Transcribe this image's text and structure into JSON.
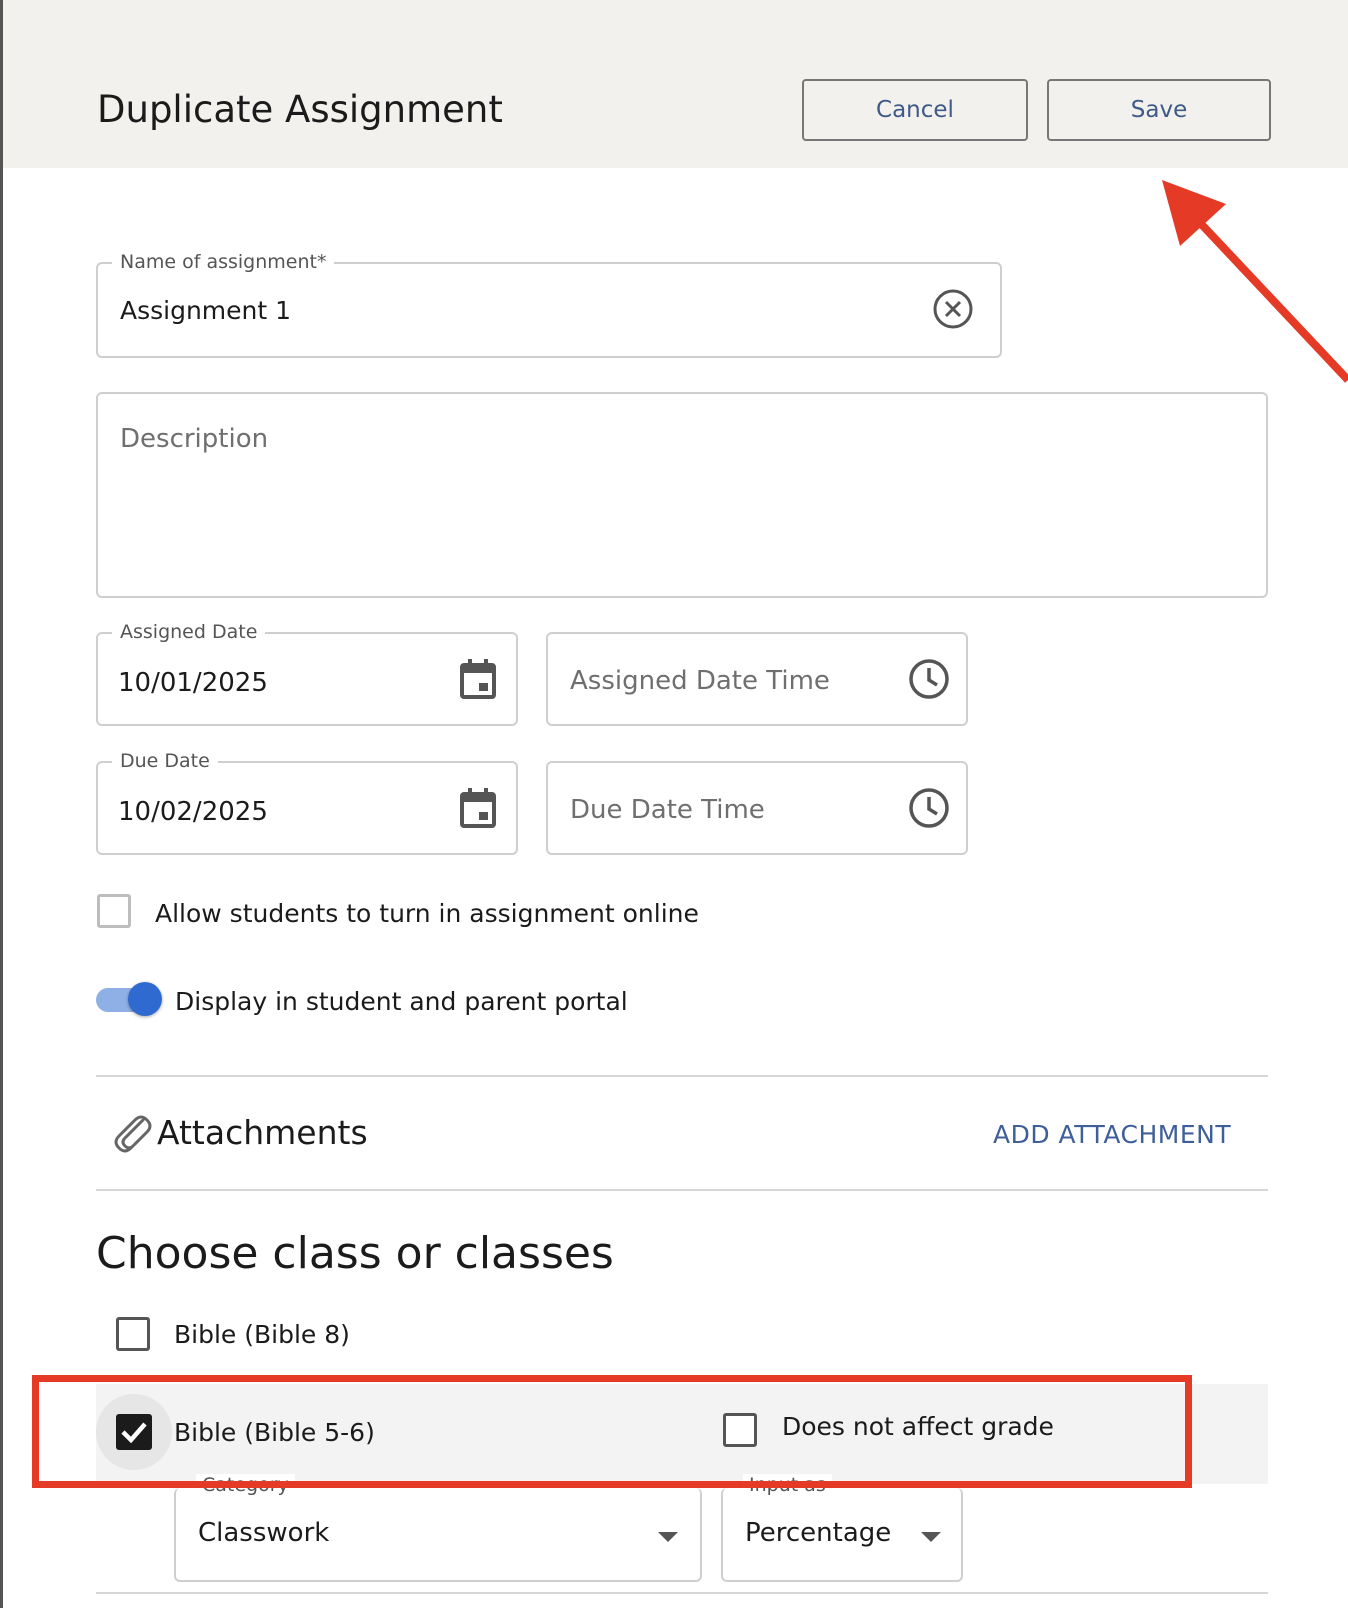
{
  "header": {
    "title": "Duplicate Assignment",
    "cancel_label": "Cancel",
    "save_label": "Save"
  },
  "form": {
    "name": {
      "label": "Name of assignment*",
      "value": "Assignment 1"
    },
    "description": {
      "placeholder": "Description",
      "value": ""
    },
    "assigned_date": {
      "label": "Assigned Date",
      "value": "10/01/2025"
    },
    "assigned_time": {
      "placeholder": "Assigned Date Time"
    },
    "due_date": {
      "label": "Due Date",
      "value": "10/02/2025"
    },
    "due_time": {
      "placeholder": "Due Date Time"
    },
    "allow_online": {
      "label": "Allow students to turn in assignment online",
      "checked": false
    },
    "display_portal": {
      "label": "Display in student and parent portal",
      "on": true
    }
  },
  "attachments": {
    "title": "Attachments",
    "add_label": "ADD ATTACHMENT"
  },
  "classes": {
    "title": "Choose class or classes",
    "items": [
      {
        "label": "Bible (Bible 8)",
        "checked": false
      },
      {
        "label": "Bible (Bible 5-6)",
        "checked": true,
        "does_not_affect_grade_label": "Does not affect grade",
        "does_not_affect_grade": false
      }
    ],
    "category": {
      "label": "Category",
      "value": "Classwork"
    },
    "input_as": {
      "label": "Input as",
      "value": "Percentage"
    }
  },
  "colors": {
    "accent": "#2f6ad0",
    "annotation": "#e53a26",
    "link": "#3f5f9a"
  },
  "icons": [
    "clear-icon",
    "calendar-icon",
    "clock-icon",
    "paperclip-icon",
    "checkmark-icon",
    "caret-down-icon"
  ]
}
